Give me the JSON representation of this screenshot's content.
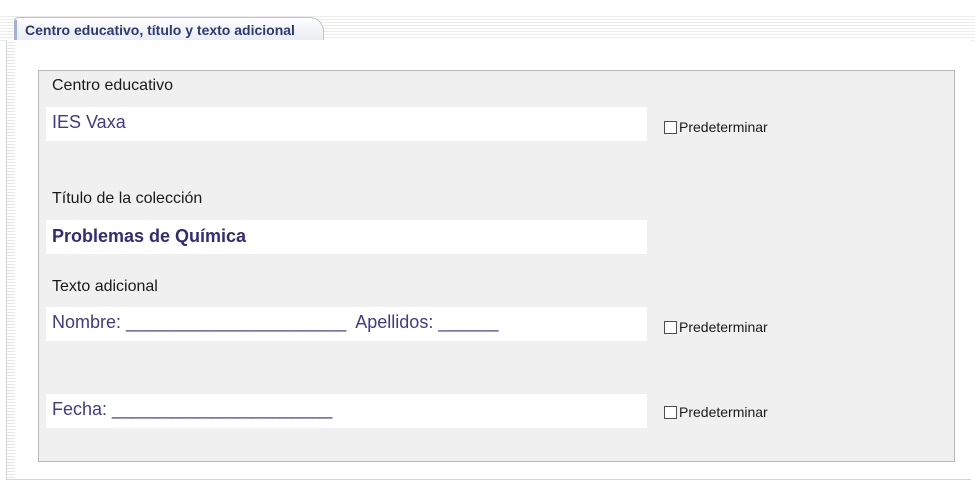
{
  "tab": {
    "label": "Centro educativo, título y texto adicional"
  },
  "fields": {
    "centro": {
      "label": "Centro educativo",
      "value": "IES Vaxa",
      "checkbox_label": "Predeterminar",
      "checked": false
    },
    "titulo": {
      "label": "Título de la colección",
      "value": "Problemas de Química"
    },
    "texto": {
      "label": "Texto adicional",
      "line1": "Nombre: ______________________  Apellidos: ______",
      "line1_checkbox_label": "Predeterminar",
      "line2": "Fecha: ______________________",
      "line2_checkbox_label": "Predeterminar"
    }
  }
}
